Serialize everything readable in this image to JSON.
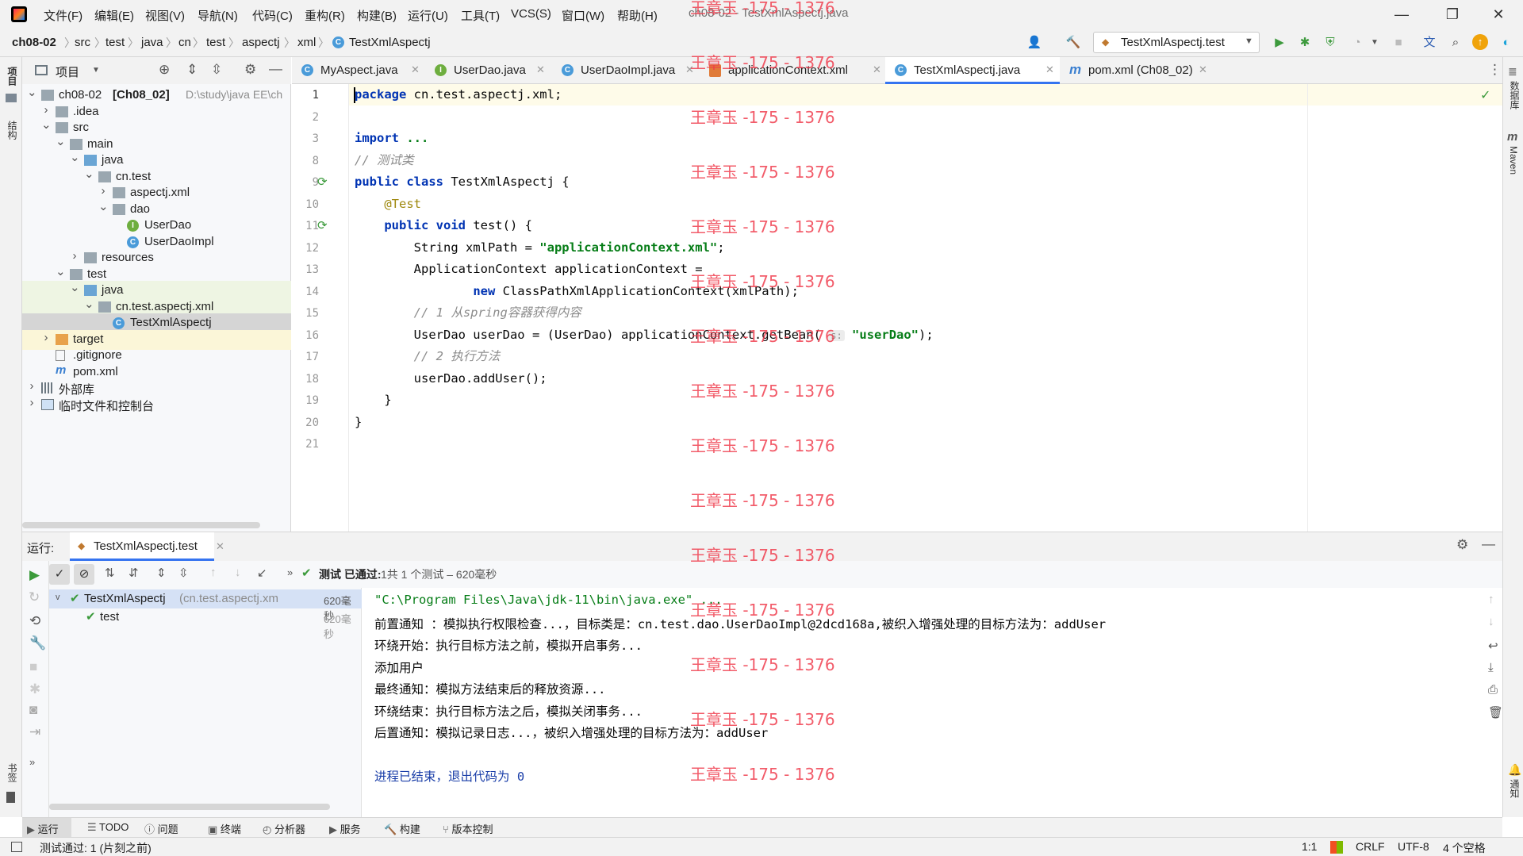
{
  "app": {
    "window_title": "ch08-02 - TestXmlAspectj.java",
    "menu": [
      "文件(F)",
      "编辑(E)",
      "视图(V)",
      "导航(N)",
      "代码(C)",
      "重构(R)",
      "构建(B)",
      "运行(U)",
      "工具(T)",
      "VCS(S)",
      "窗口(W)",
      "帮助(H)"
    ]
  },
  "breadcrumb": [
    "ch08-02",
    "src",
    "test",
    "java",
    "cn",
    "test",
    "aspectj",
    "xml",
    "TestXmlAspectj"
  ],
  "run_config": "TestXmlAspectj.test",
  "left_stripe": {
    "project": "项目",
    "structure": "结构",
    "bookmarks": "书签"
  },
  "right_stripe": {
    "database": "数据库",
    "maven": "Maven",
    "notifications": "通知"
  },
  "project_panel": {
    "title": "项目",
    "tree": [
      {
        "label": "ch08-02",
        "bold": "[Ch08_02]",
        "path": "D:\\study\\java EE\\ch",
        "depth": 0,
        "arrow": "v",
        "icon": "folder"
      },
      {
        "label": ".idea",
        "depth": 1,
        "arrow": ">",
        "icon": "folder"
      },
      {
        "label": "src",
        "depth": 1,
        "arrow": "v",
        "icon": "folder"
      },
      {
        "label": "main",
        "depth": 2,
        "arrow": "v",
        "icon": "folder"
      },
      {
        "label": "java",
        "depth": 3,
        "arrow": "v",
        "icon": "folder-blue"
      },
      {
        "label": "cn.test",
        "depth": 4,
        "arrow": "v",
        "icon": "folder"
      },
      {
        "label": "aspectj.xml",
        "depth": 5,
        "arrow": ">",
        "icon": "folder"
      },
      {
        "label": "dao",
        "depth": 5,
        "arrow": "v",
        "icon": "folder"
      },
      {
        "label": "UserDao",
        "depth": 6,
        "arrow": "",
        "icon": "interface"
      },
      {
        "label": "UserDaoImpl",
        "depth": 6,
        "arrow": "",
        "icon": "class"
      },
      {
        "label": "resources",
        "depth": 3,
        "arrow": ">",
        "icon": "folder"
      },
      {
        "label": "test",
        "depth": 2,
        "arrow": "v",
        "icon": "folder"
      },
      {
        "label": "java",
        "depth": 3,
        "arrow": "v",
        "icon": "folder-green"
      },
      {
        "label": "cn.test.aspectj.xml",
        "depth": 4,
        "arrow": "v",
        "icon": "folder"
      },
      {
        "label": "TestXmlAspectj",
        "depth": 5,
        "arrow": "",
        "icon": "class"
      },
      {
        "label": "target",
        "depth": 1,
        "arrow": ">",
        "icon": "folder-orange"
      },
      {
        "label": ".gitignore",
        "depth": 1,
        "arrow": "",
        "icon": "file"
      },
      {
        "label": "pom.xml",
        "depth": 1,
        "arrow": "",
        "icon": "maven"
      },
      {
        "label": "外部库",
        "depth": 0,
        "arrow": ">",
        "icon": "library"
      },
      {
        "label": "临时文件和控制台",
        "depth": 0,
        "arrow": ">",
        "icon": "scratch"
      }
    ]
  },
  "tabs": [
    {
      "label": "MyAspect.java",
      "icon": "C"
    },
    {
      "label": "UserDao.java",
      "icon": "I"
    },
    {
      "label": "UserDaoImpl.java",
      "icon": "C"
    },
    {
      "label": "applicationContext.xml",
      "icon": "xml"
    },
    {
      "label": "TestXmlAspectj.java",
      "icon": "C",
      "active": true
    },
    {
      "label": "pom.xml (Ch08_02)",
      "icon": "m"
    }
  ],
  "editor": {
    "line_numbers": [
      "1",
      "2",
      "3",
      "8",
      "9",
      "10",
      "11",
      "12",
      "13",
      "14",
      "15",
      "16",
      "17",
      "18",
      "19",
      "20",
      "21"
    ],
    "lines": [
      [
        {
          "t": "package",
          "c": "kw"
        },
        {
          "t": " cn.test.aspectj.xml;"
        }
      ],
      [],
      [
        {
          "t": "import",
          "c": "kw"
        },
        {
          "t": " ...",
          "c": "str"
        }
      ],
      [
        {
          "t": "// 测试类",
          "c": "cm"
        }
      ],
      [
        {
          "t": "public class",
          "c": "kw"
        },
        {
          "t": " TestXmlAspectj {"
        }
      ],
      [
        {
          "t": "    "
        },
        {
          "t": "@Test",
          "c": "ann"
        }
      ],
      [
        {
          "t": "    "
        },
        {
          "t": "public void",
          "c": "kw"
        },
        {
          "t": " test() {"
        }
      ],
      [
        {
          "t": "        String xmlPath = "
        },
        {
          "t": "\"applicationContext.xml\"",
          "c": "str"
        },
        {
          "t": ";"
        }
      ],
      [
        {
          "t": "        ApplicationContext applicationContext ="
        }
      ],
      [
        {
          "t": "                "
        },
        {
          "t": "new",
          "c": "kw"
        },
        {
          "t": " ClassPathXmlApplicationContext(xmlPath);"
        }
      ],
      [
        {
          "t": "        "
        },
        {
          "t": "// 1 从spring容器获得内容",
          "c": "cm"
        }
      ],
      [
        {
          "t": "        UserDao userDao = (UserDao) applicationContext.getBean( "
        },
        {
          "t": "s:",
          "c": "hint"
        },
        {
          "t": " "
        },
        {
          "t": "\"userDao\"",
          "c": "str"
        },
        {
          "t": ");"
        }
      ],
      [
        {
          "t": "        "
        },
        {
          "t": "// 2 执行方法",
          "c": "cm"
        }
      ],
      [
        {
          "t": "        userDao.addUser();"
        }
      ],
      [
        {
          "t": "    }"
        }
      ],
      [
        {
          "t": "}"
        }
      ],
      []
    ]
  },
  "watermark": "王章玉 -175 - 1376",
  "run_panel": {
    "title": "运行:",
    "tab": "TestXmlAspectj.test",
    "status": "测试 已通过:",
    "status_count": "1共 1 个测试 – 620毫秒",
    "tests": [
      {
        "name": "TestXmlAspectj",
        "detail": "(cn.test.aspectj.xm",
        "time": "620毫秒"
      },
      {
        "name": "test",
        "detail": "",
        "time": "620毫秒"
      }
    ],
    "console": [
      "\"C:\\Program Files\\Java\\jdk-11\\bin\\java.exe\" ...",
      "前置通知 ：模拟执行权限检查...，目标类是：cn.test.dao.UserDaoImpl@2dcd168a,被织入增强处理的目标方法为：addUser",
      "环绕开始：执行目标方法之前，模拟开启事务...",
      "添加用户",
      "最终通知：模拟方法结束后的释放资源...",
      "环绕结束：执行目标方法之后，模拟关闭事务...",
      "后置通知：模拟记录日志...，被织入增强处理的目标方法为：addUser",
      "",
      "进程已结束，退出代码为 0"
    ]
  },
  "bottom_tools": [
    "运行",
    "TODO",
    "问题",
    "终端",
    "分析器",
    "服务",
    "构建",
    "版本控制"
  ],
  "status_bar": {
    "message": "测试通过: 1 (片刻之前)",
    "position": "1:1",
    "line_sep": "CRLF",
    "encoding": "UTF-8",
    "indent": "4 个空格"
  },
  "colors": {
    "accent": "#3574f0",
    "keyword": "#0033b3",
    "string": "#067d17",
    "comment": "#8c8c8c",
    "watermark": "#f0394a"
  }
}
